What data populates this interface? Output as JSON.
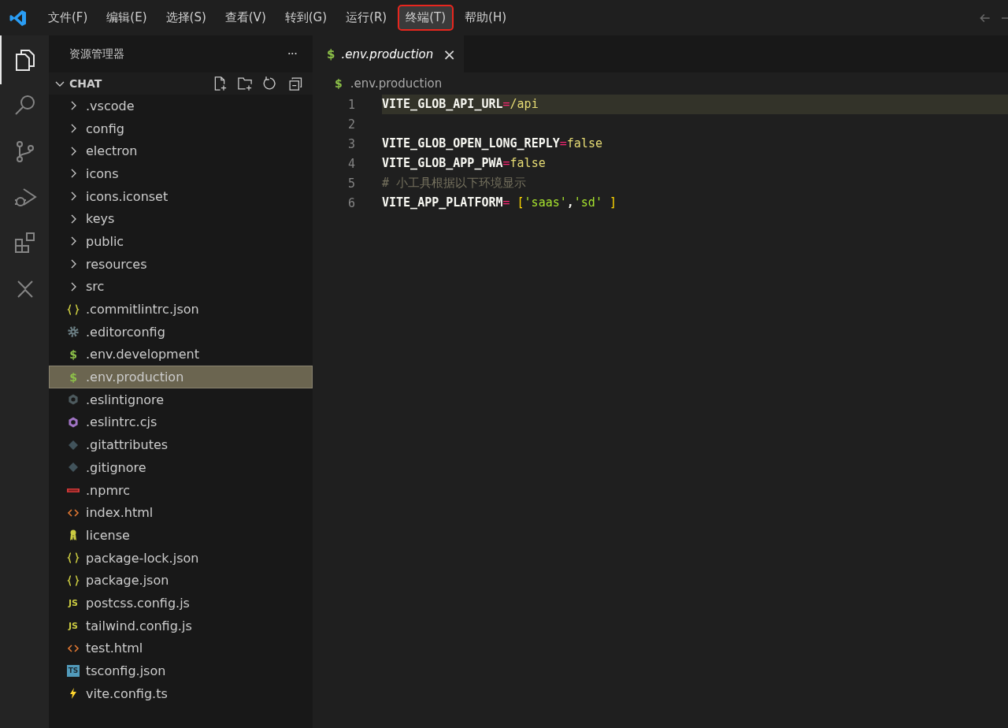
{
  "menu": [
    {
      "label": "文件(F)",
      "selected": false
    },
    {
      "label": "编辑(E)",
      "selected": false
    },
    {
      "label": "选择(S)",
      "selected": false
    },
    {
      "label": "查看(V)",
      "selected": false
    },
    {
      "label": "转到(G)",
      "selected": false
    },
    {
      "label": "运行(R)",
      "selected": false
    },
    {
      "label": "终端(T)",
      "selected": true
    },
    {
      "label": "帮助(H)",
      "selected": false
    }
  ],
  "activity_bar": [
    {
      "kind": "files",
      "selected": true
    },
    {
      "kind": "search",
      "selected": false
    },
    {
      "kind": "git",
      "selected": false
    },
    {
      "kind": "debug",
      "selected": false
    },
    {
      "kind": "extensions",
      "selected": false
    },
    {
      "kind": "remote",
      "selected": false
    }
  ],
  "sidebar": {
    "title": "资源管理器",
    "more": "···",
    "folder": {
      "name": "CHAT",
      "expanded": true
    },
    "items": [
      {
        "name": ".vscode",
        "kind": "folder",
        "selected": false
      },
      {
        "name": "config",
        "kind": "folder",
        "selected": false
      },
      {
        "name": "electron",
        "kind": "folder",
        "selected": false
      },
      {
        "name": "icons",
        "kind": "folder",
        "selected": false
      },
      {
        "name": "icons.iconset",
        "kind": "folder",
        "selected": false
      },
      {
        "name": "keys",
        "kind": "folder",
        "selected": false
      },
      {
        "name": "public",
        "kind": "folder",
        "selected": false
      },
      {
        "name": "resources",
        "kind": "folder",
        "selected": false
      },
      {
        "name": "src",
        "kind": "folder",
        "selected": false
      },
      {
        "name": ".commitlintrc.json",
        "kind": "json",
        "selected": false
      },
      {
        "name": ".editorconfig",
        "kind": "gear",
        "selected": false
      },
      {
        "name": ".env.development",
        "kind": "env",
        "icon": "$",
        "selected": false
      },
      {
        "name": ".env.production",
        "kind": "env",
        "icon": "$",
        "selected": true
      },
      {
        "name": ".eslintignore",
        "kind": "eslintignore",
        "selected": false
      },
      {
        "name": ".eslintrc.cjs",
        "kind": "eslint",
        "selected": false
      },
      {
        "name": ".gitattributes",
        "kind": "git",
        "selected": false
      },
      {
        "name": ".gitignore",
        "kind": "git",
        "selected": false
      },
      {
        "name": ".npmrc",
        "kind": "npm",
        "selected": false
      },
      {
        "name": "index.html",
        "kind": "html",
        "selected": false
      },
      {
        "name": "license",
        "kind": "license",
        "selected": false
      },
      {
        "name": "package-lock.json",
        "kind": "json",
        "selected": false
      },
      {
        "name": "package.json",
        "kind": "json",
        "selected": false
      },
      {
        "name": "postcss.config.js",
        "kind": "js",
        "icon": "JS",
        "selected": false
      },
      {
        "name": "tailwind.config.js",
        "kind": "js",
        "icon": "JS",
        "selected": false
      },
      {
        "name": "test.html",
        "kind": "html",
        "selected": false
      },
      {
        "name": "tsconfig.json",
        "kind": "ts",
        "icon": "TS",
        "selected": false
      },
      {
        "name": "vite.config.ts",
        "kind": "vite",
        "selected": false
      }
    ]
  },
  "editor": {
    "tab": {
      "icon": "$",
      "label": ".env.production",
      "close": "×"
    },
    "breadcrumb": {
      "icon": "$",
      "label": ".env.production"
    },
    "lines": [
      {
        "number": "1",
        "current": true,
        "tokens": [
          {
            "kind": "key",
            "text": "VITE_GLOB_API_URL"
          },
          {
            "kind": "op",
            "text": "="
          },
          {
            "kind": "value",
            "text": "/api"
          }
        ]
      },
      {
        "number": "2",
        "current": false
      },
      {
        "number": "3",
        "current": false,
        "tokens": [
          {
            "kind": "key",
            "text": "VITE_GLOB_OPEN_LONG_REPLY"
          },
          {
            "kind": "op",
            "text": "="
          },
          {
            "kind": "value",
            "text": "false"
          }
        ]
      },
      {
        "number": "4",
        "current": false,
        "tokens": [
          {
            "kind": "key",
            "text": "VITE_GLOB_APP_PWA"
          },
          {
            "kind": "op",
            "text": "="
          },
          {
            "kind": "value",
            "text": "false"
          }
        ]
      },
      {
        "number": "5",
        "current": false,
        "tokens": [
          {
            "kind": "comment",
            "text": "# 小工具根据以下环境显示"
          }
        ]
      },
      {
        "number": "6",
        "current": false,
        "tokens": [
          {
            "kind": "key",
            "text": "VITE_APP_PLATFORM"
          },
          {
            "kind": "op",
            "text": "="
          },
          {
            "kind": "bracket",
            "text": "["
          },
          {
            "kind": "string",
            "text": "'saas'"
          },
          {
            "kind": "key",
            "text": ","
          },
          {
            "kind": "string",
            "text": "'sd'"
          },
          {
            "kind": "bracket",
            "text": "]"
          }
        ]
      }
    ]
  }
}
